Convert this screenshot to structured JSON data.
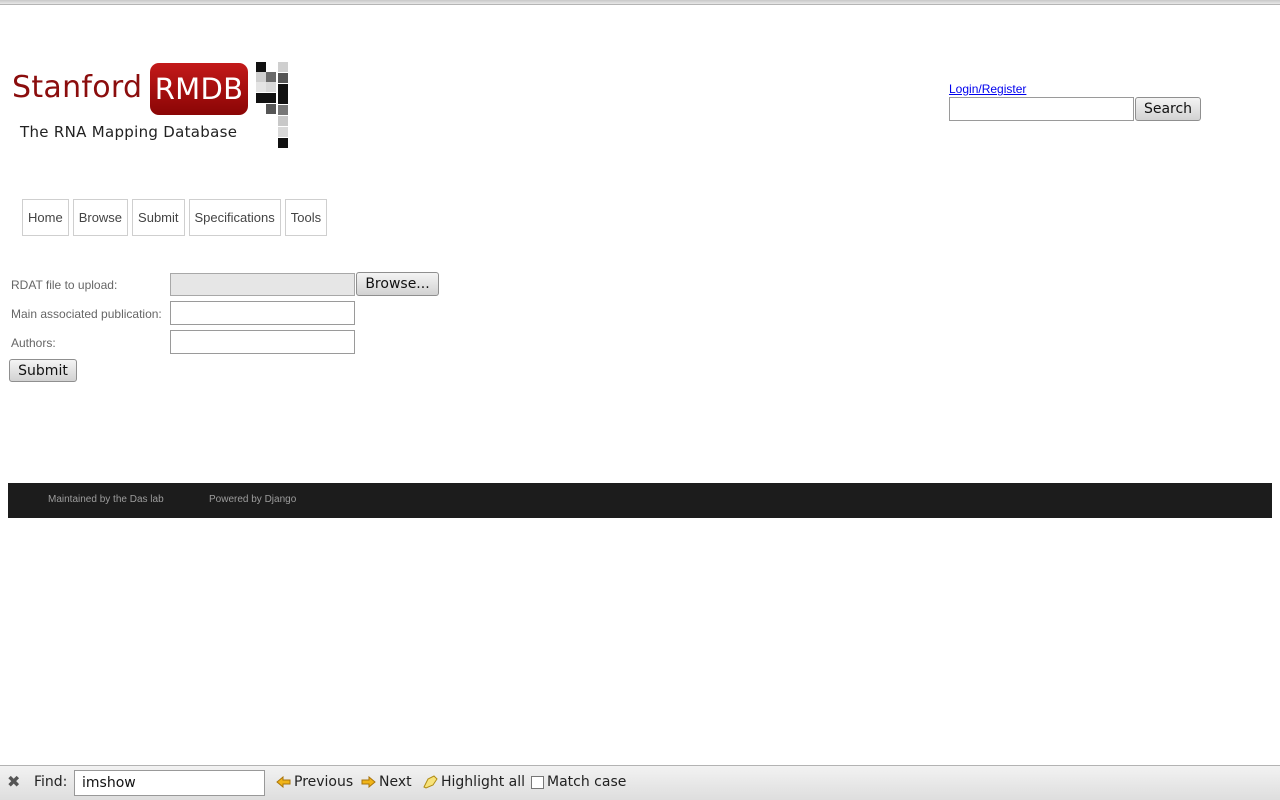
{
  "logo": {
    "brand_word": "Stanford",
    "brand_box": "RMDB",
    "subtitle": "The RNA Mapping Database",
    "brand_color": "#8b0d0d",
    "brand_box_color": "#b01212"
  },
  "header": {
    "login_link": "Login/Register",
    "search_value": "",
    "search_button": "Search"
  },
  "nav": {
    "items": [
      {
        "label": "Home"
      },
      {
        "label": "Browse"
      },
      {
        "label": "Submit"
      },
      {
        "label": "Specifications"
      },
      {
        "label": "Tools"
      }
    ]
  },
  "form": {
    "file_label": "RDAT file to upload:",
    "browse_button": "Browse...",
    "publication_label": "Main associated publication:",
    "publication_value": "",
    "authors_label": "Authors:",
    "authors_value": "",
    "submit_button": "Submit"
  },
  "footer": {
    "maintained": "Maintained by the Das lab",
    "powered": "Powered by Django",
    "background": "#1c1c1c"
  },
  "findbar": {
    "label": "Find:",
    "query": "imshow",
    "previous": "Previous",
    "next": "Next",
    "highlight_all": "Highlight all",
    "match_case": "Match case",
    "match_case_checked": false
  }
}
